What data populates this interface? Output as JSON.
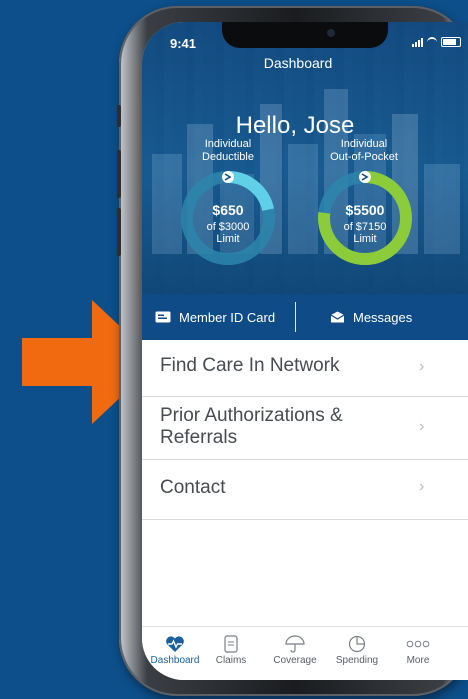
{
  "status_bar": {
    "time": "9:41"
  },
  "header": {
    "title": "Dashboard",
    "greeting": "Hello, Jose"
  },
  "deductible": {
    "label_line1": "Individual",
    "label_line2": "Deductible",
    "amount": "$650",
    "sub_line1": "of $3000",
    "sub_line2": "Limit",
    "progress": 0.217,
    "color": "#5fd0e6"
  },
  "out_of_pocket": {
    "label_line1": "Individual",
    "label_line2": "Out-of-Pocket",
    "amount": "$5500",
    "sub_line1": "of $7150",
    "sub_line2": "Limit",
    "progress": 0.769,
    "color": "#8ccc3a"
  },
  "actions": {
    "member_id": "Member ID Card",
    "messages": "Messages"
  },
  "menu": {
    "find_care": "Find Care In Network",
    "prior_auth_line1": "Prior Authorizations &",
    "prior_auth_line2": "Referrals",
    "contact": "Contact"
  },
  "tabs": {
    "dashboard": "Dashboard",
    "claims": "Claims",
    "coverage": "Coverage",
    "spending": "Spending",
    "more": "More"
  },
  "colors": {
    "background": "#0d4f8a",
    "arrow": "#f26a10",
    "active_tab": "#1a5f9e"
  }
}
